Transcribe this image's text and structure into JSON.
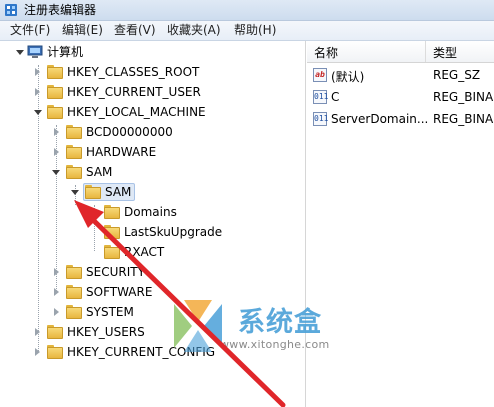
{
  "window": {
    "title": "注册表编辑器"
  },
  "menu": [
    {
      "label": "文件(F)"
    },
    {
      "label": "编辑(E)"
    },
    {
      "label": "查看(V)"
    },
    {
      "label": "收藏夹(A)"
    },
    {
      "label": "帮助(H)"
    }
  ],
  "tree": {
    "root": "计算机",
    "hkcr": "HKEY_CLASSES_ROOT",
    "hkcu": "HKEY_CURRENT_USER",
    "hklm": "HKEY_LOCAL_MACHINE",
    "bcd": "BCD00000000",
    "hardware": "HARDWARE",
    "sam": "SAM",
    "sam_sub": "SAM",
    "domains": "Domains",
    "lastsku": "LastSkuUpgrade",
    "rxact": "RXACT",
    "security": "SECURITY",
    "software": "SOFTWARE",
    "system": "SYSTEM",
    "hku": "HKEY_USERS",
    "hkcc": "HKEY_CURRENT_CONFIG",
    "selected": "SAM"
  },
  "values_pane": {
    "columns": {
      "name": "名称",
      "type": "类型"
    },
    "rows": [
      {
        "icon": "ab",
        "name": "(默认)",
        "type": "REG_SZ"
      },
      {
        "icon": "011",
        "name": "C",
        "type": "REG_BINA"
      },
      {
        "icon": "011",
        "name": "ServerDomain...",
        "type": "REG_BINA"
      }
    ]
  },
  "watermark": {
    "brand": "系统盒",
    "url": "www.xitonghe.com"
  },
  "colors": {
    "selection": "#dfe9f6",
    "folder": "#f7d979",
    "arrow": "#e0262a",
    "watermark": "#4aa0d8"
  },
  "icons": [
    "regedit-app-icon",
    "computer-icon",
    "folder-icon",
    "string-value-icon",
    "binary-value-icon"
  ]
}
